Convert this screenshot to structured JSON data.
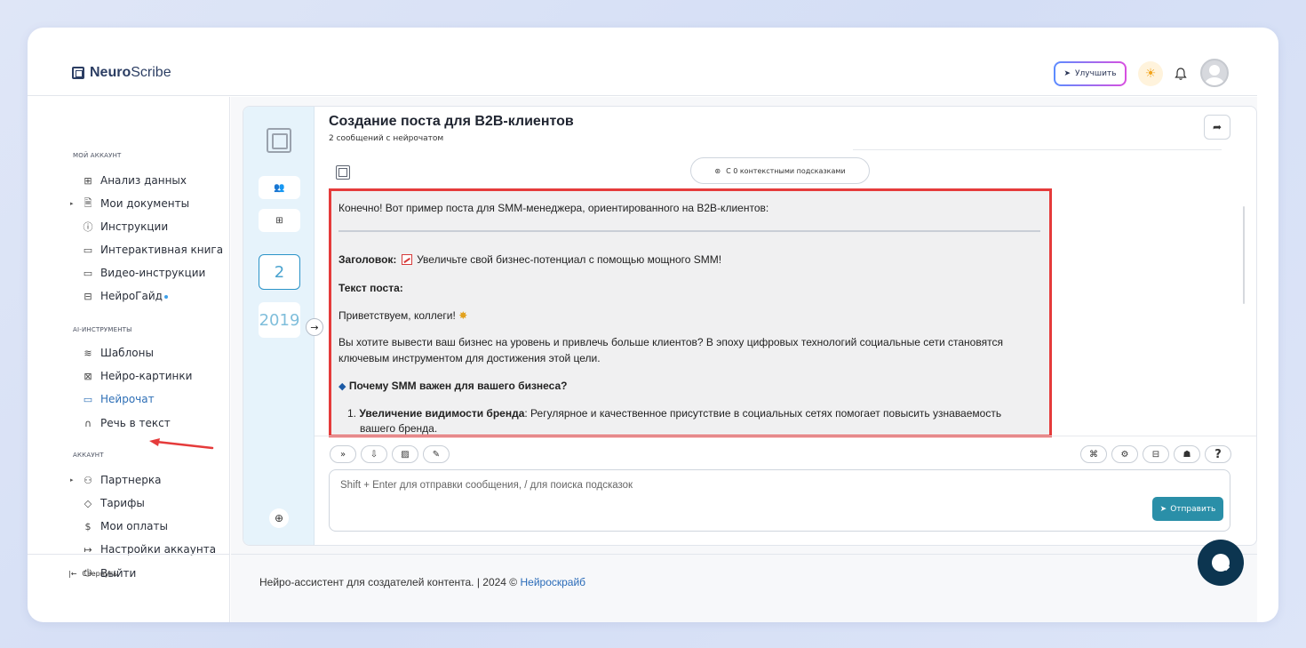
{
  "header": {
    "logo_bold": "Neuro",
    "logo_regular": "Scribe",
    "upgrade_label": "Улучшить"
  },
  "sidebar": {
    "sections": {
      "account": "МОЙ АККАУНТ",
      "ai_tools": "AI-ИНСТРУМЕНТЫ",
      "account2": "АККАУНТ"
    },
    "items": {
      "analytics": "Анализ данных",
      "documents": "Мои документы",
      "instructions": "Инструкции",
      "interactive_book": "Интерактивная книга",
      "video_instructions": "Видео-инструкции",
      "neuroguide": "НейроГайд",
      "templates": "Шаблоны",
      "neuro_images": "Нейро-картинки",
      "neurochat": "Нейрочат",
      "speech_to_text": "Речь в текст",
      "partner": "Партнерка",
      "tariffs": "Тарифы",
      "payments": "Мои оплаты",
      "account_settings": "Настройки аккаунта",
      "logout": "Выйти"
    },
    "collapse_label": "Свернуть"
  },
  "rail": {
    "counter": "2",
    "year": "2019"
  },
  "chat": {
    "title": "Создание поста для B2B-клиентов",
    "subtitle": "2 сообщений с нейрочатом",
    "context_label": "С 0 контекстными подсказками",
    "message": {
      "intro": "Конечно! Вот пример поста для SMM-менеджера, ориентированного на B2B-клиентов:",
      "heading_label": "Заголовок:",
      "heading_text": "Увеличьте свой бизнес-потенциал с помощью мощного SMM!",
      "post_text_label": "Текст поста:",
      "greeting": "Приветствуем, коллеги!",
      "body_line1": "Вы хотите вывести ваш бизнес на уровень и привлечь больше клиентов? В эпоху цифровых технологий социальные сети становятся",
      "body_line2": "ключевым инструментом для достижения этой цели.",
      "why_heading": "Почему SMM важен для вашего бизнеса?",
      "item1_number": "1.",
      "item1_bold": "Увеличение видимости бренда",
      "item1_text": ": Регулярное и качественное присутствие в социальных сетях помогает повысить узнаваемость",
      "item1_line2": "вашего бренда."
    },
    "input_placeholder": "Shift + Enter для отправки сообщения, / для поиска подсказок",
    "send_label": "Отправить",
    "help_label": "?"
  },
  "footer": {
    "text": "Нейро-ассистент для создателей контента.  | 2024 © ",
    "link": "Нейроскрайб"
  },
  "colors": {
    "accent": "#2a8fa8",
    "highlight_border": "#e53b3b",
    "link": "#2a6bb8",
    "rail_bg": "#e6f3fb"
  }
}
